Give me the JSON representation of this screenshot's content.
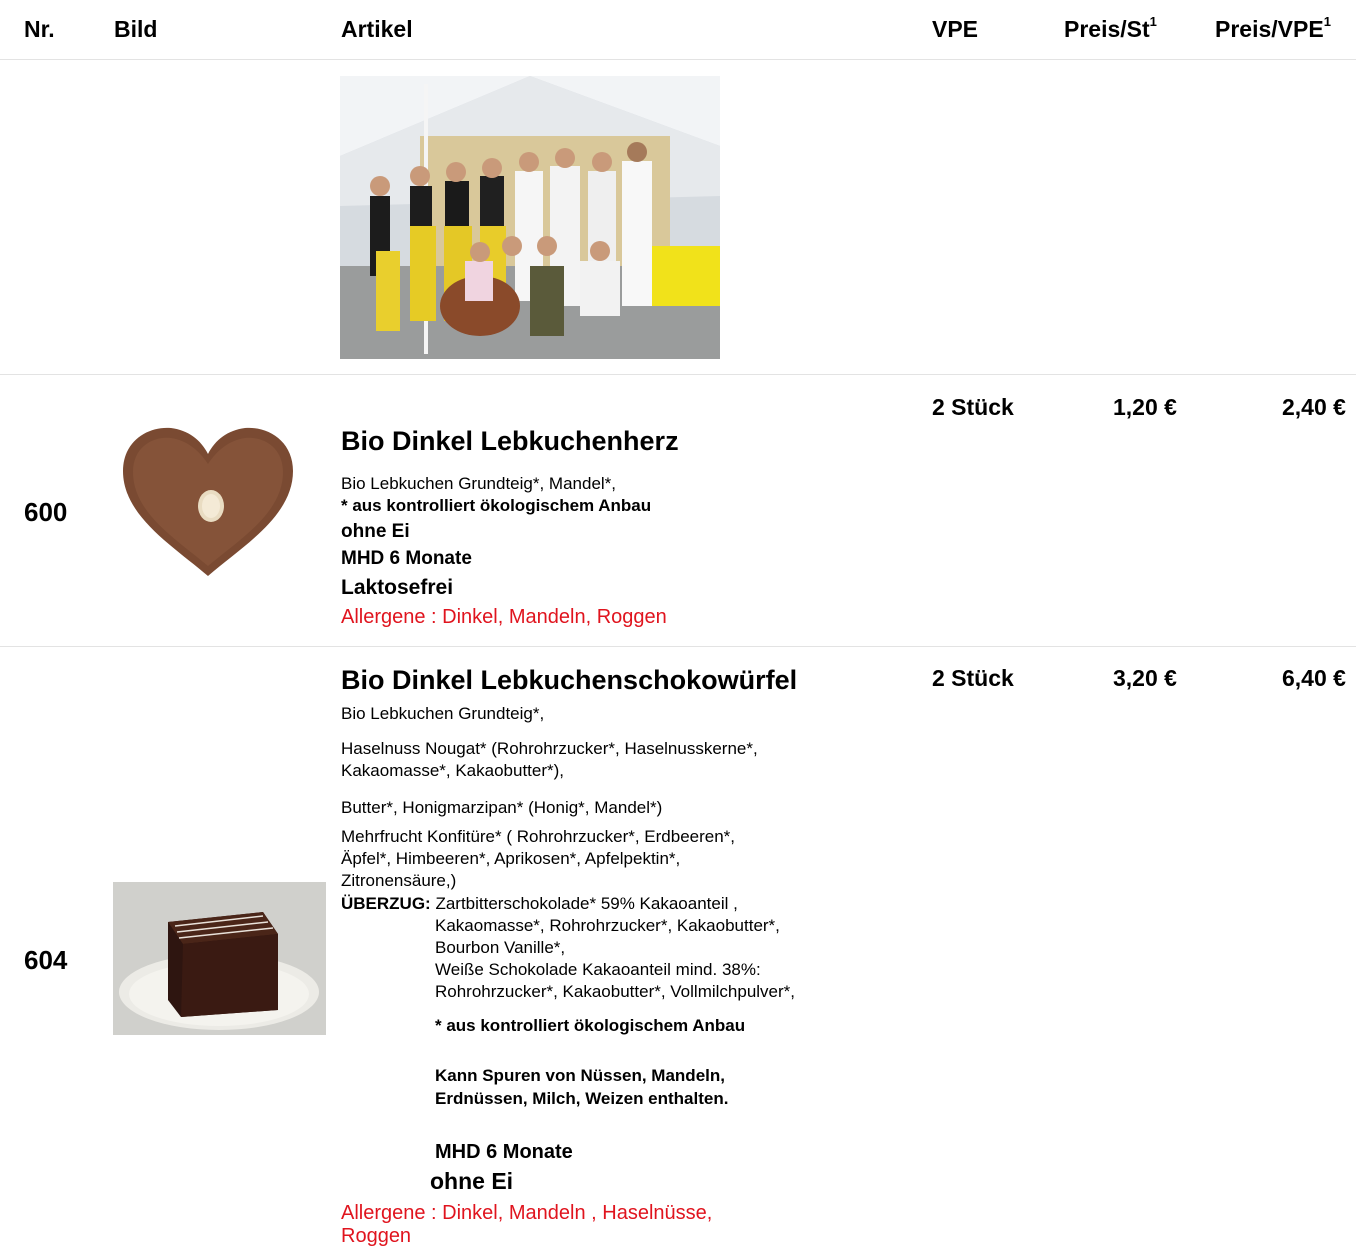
{
  "header": {
    "nr": "Nr.",
    "bild": "Bild",
    "artikel": "Artikel",
    "vpe": "VPE",
    "preis_st": "Preis/St",
    "preis_vpe": "Preis/VPE",
    "footnote_mark": "1"
  },
  "items": [
    {
      "nr": "600",
      "title": "Bio Dinkel Lebkuchenherz",
      "lines": [
        "Bio Lebkuchen Grundteig*, Mandel*,",
        "* aus kontrolliert ökologischem Anbau",
        "ohne Ei",
        "MHD 6 Monate",
        "Laktosefrei"
      ],
      "allergens": "Allergene : Dinkel, Mandeln, Roggen",
      "vpe": "2 Stück",
      "preis_st": "1,20 €",
      "preis_vpe": "2,40 €"
    },
    {
      "nr": "604",
      "title": "Bio Dinkel Lebkuchenschokowürfel",
      "lines": [
        "Bio Lebkuchen Grundteig*,",
        "Haselnuss Nougat* (",
        "Rohrohrzucker*, Haselnusskerne*,",
        "Kakaomasse*, Kakaobutter*),",
        "Butter*, Honigmarzipan* (",
        "Honig*, Mandel*)",
        "Mehrfrucht Konfitüre* ( Rohrohrzucker*, Erdbeeren*,",
        "Äpfel*, Himbeeren*, Aprikosen*, Apfelpektin*,",
        "Zitronensäure,)",
        "ÜBERZUG:",
        "Zartbitterschokolade* 59% Kakaoanteil ,",
        "Kakaomasse*, Rohrohrzucker*, Kakaobutter*,",
        "Bourbon Vanille*,",
        "Weiße Schokolade  Kakaoanteil mind. 38%:",
        "Rohrohrzucker*, Kakaobutter*, Vollmilchpulver*,",
        "* aus kontrolliert ökologischem Anbau",
        "Kann Spuren von Nüssen, Mandeln,",
        "Erdnüssen, Milch, Weizen enthalten.",
        "MHD 6 Monate",
        "ohne Ei"
      ],
      "allergens_1": "Allergene : Dinkel, Mandeln , Haselnüsse,",
      "allergens_2": "Roggen",
      "vpe": "2 Stück",
      "preis_st": "3,20 €",
      "preis_vpe": "6,40 €"
    }
  ],
  "colors": {
    "allergen_red": "#e0141e",
    "rule_gray": "#e3e3e3"
  }
}
